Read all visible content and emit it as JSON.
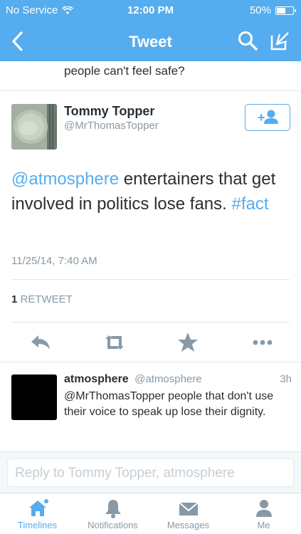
{
  "status_bar": {
    "carrier": "No Service",
    "time": "12:00 PM",
    "battery": "50%",
    "battery_level": 0.5
  },
  "nav": {
    "title": "Tweet",
    "back_icon": "chevron-left-icon",
    "search_icon": "search-icon",
    "compose_icon": "compose-icon"
  },
  "previous_tweet": {
    "text": "people can't feel safe?"
  },
  "tweet": {
    "author_name": "Tommy Topper",
    "author_handle": "@MrThomasTopper",
    "mention": "@atmosphere",
    "text_body": " entertainers that get involved in politics lose fans. ",
    "hashtag": "#fact",
    "timestamp": "11/25/14, 7:40 AM",
    "retweet_count": "1",
    "retweet_label": "RETWEET"
  },
  "reply": {
    "author_name": "atmosphere",
    "author_handle": "@atmosphere",
    "time": "3h",
    "text": "@MrThomasTopper people that don't use their voice to speak up lose their dignity."
  },
  "reply_box": {
    "placeholder": "Reply to Tommy Topper, atmosphere"
  },
  "tabs": [
    {
      "label": "Timelines",
      "icon": "home-icon"
    },
    {
      "label": "Notifications",
      "icon": "bell-icon"
    },
    {
      "label": "Messages",
      "icon": "envelope-icon"
    },
    {
      "label": "Me",
      "icon": "person-icon"
    }
  ],
  "colors": {
    "accent": "#55acee",
    "muted": "#8899a6",
    "text": "#292f33"
  }
}
